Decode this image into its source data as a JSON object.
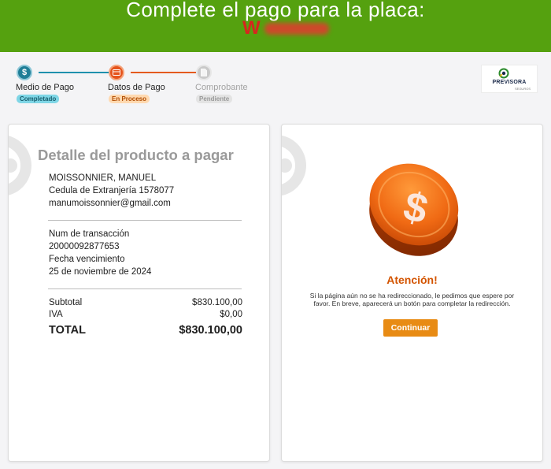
{
  "header": {
    "title": "Complete el pago para la placa:",
    "plate_visible": "W"
  },
  "stepper": {
    "steps": [
      {
        "icon": "dollar-icon",
        "label": "Medio de Pago",
        "status": "Completado",
        "color": "#1f7e97"
      },
      {
        "icon": "credit-card-icon",
        "label": "Datos de Pago",
        "status": "En Proceso",
        "color": "#e5541c"
      },
      {
        "icon": "document-icon",
        "label": "Comprobante",
        "status": "Pendiente",
        "color": "#c9c9c9"
      }
    ]
  },
  "logo": {
    "brand": "PREVISORA",
    "sub": "SEGUROS"
  },
  "detail": {
    "heading": "Detalle del producto a pagar",
    "name": "MOISSONNIER, MANUEL",
    "document": "Cedula de Extranjería 1578077",
    "email": "manumoissonnier@gmail.com",
    "transaction_label": "Num de transacción",
    "transaction_number": "20000092877653",
    "due_label": "Fecha vencimiento",
    "due_date": "25 de noviembre de 2024",
    "subtotal_label": "Subtotal",
    "subtotal_value": "$830.100,00",
    "iva_label": "IVA",
    "iva_value": "$0,00",
    "total_label": "TOTAL",
    "total_value": "$830.100,00"
  },
  "notice": {
    "heading": "Atención!",
    "message": "Si la página aún no se ha redireccionado, le pedimos que espere por favor. En breve, aparecerá un botón para completar la redirección.",
    "button": "Continuar",
    "accent": "#e88b14"
  },
  "colors": {
    "header_green": "#55a10f",
    "plate_red": "#d7261e"
  }
}
